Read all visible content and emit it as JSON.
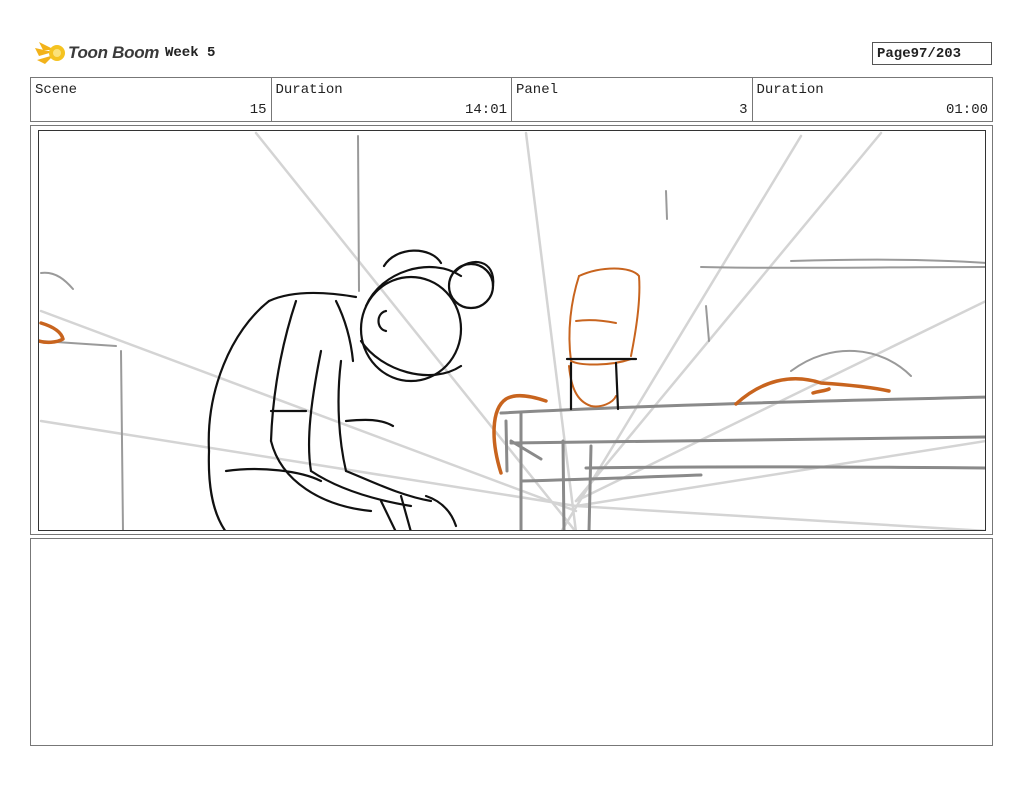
{
  "header": {
    "logo_text": "Toon Boom",
    "project_title": "Week 5",
    "page_label": "Page",
    "page_value": "97/203"
  },
  "info": [
    {
      "label": "Scene",
      "value": "15"
    },
    {
      "label": "Duration",
      "value": "14:01"
    },
    {
      "label": "Panel",
      "value": "3"
    },
    {
      "label": "Duration",
      "value": "01:00"
    }
  ],
  "colors": {
    "sketch_line": "#111111",
    "guide_line": "#c8c8c8",
    "rough_orange": "#c8641e",
    "table_gray": "#8a8a8a"
  },
  "notes": {
    "text": ""
  }
}
